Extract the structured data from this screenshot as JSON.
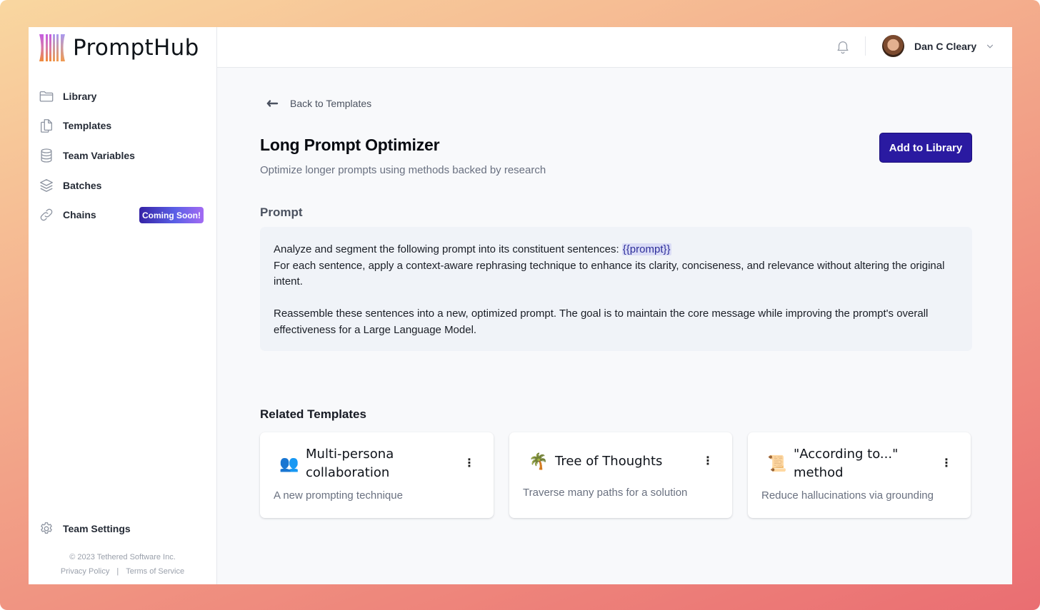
{
  "app": {
    "name": "PromptHub"
  },
  "sidebar": {
    "items": [
      {
        "label": "Library",
        "icon": "folder-icon"
      },
      {
        "label": "Templates",
        "icon": "documents-icon"
      },
      {
        "label": "Team Variables",
        "icon": "database-icon"
      },
      {
        "label": "Batches",
        "icon": "layers-icon"
      },
      {
        "label": "Chains",
        "icon": "link-icon",
        "badge": "Coming Soon!"
      }
    ],
    "settings": {
      "label": "Team Settings",
      "icon": "gear-icon"
    },
    "footer": {
      "copyright": "© 2023 Tethered Software Inc.",
      "privacy": "Privacy Policy",
      "separator": "|",
      "terms": "Terms of Service"
    }
  },
  "topbar": {
    "notifications_icon": "bell-icon",
    "user_name": "Dan C Cleary"
  },
  "page": {
    "back_label": "Back to Templates",
    "title": "Long Prompt Optimizer",
    "subtitle": "Optimize longer prompts using methods backed by research",
    "add_button": "Add to Library",
    "prompt_heading": "Prompt",
    "prompt": {
      "line1_text": "Analyze and segment the following prompt into its constituent sentences: ",
      "line1_variable": "{{prompt}}",
      "line2": "For each sentence, apply a context-aware rephrasing technique to enhance its clarity, conciseness, and relevance without altering the original intent.",
      "paragraph2": "Reassemble these sentences into a new, optimized prompt. The goal is to maintain the core message while improving the prompt's overall effectiveness for a Large Language Model."
    },
    "related_heading": "Related Templates",
    "related": [
      {
        "emoji": "👥",
        "title": "Multi-persona collaboration",
        "description": "A new prompting technique"
      },
      {
        "emoji": "🌴",
        "title": "Tree of Thoughts",
        "description": "Traverse many paths for a solution"
      },
      {
        "emoji": "📜",
        "title": "\"According to...\" method",
        "description": "Reduce hallucinations via grounding"
      }
    ]
  },
  "colors": {
    "accent": "#2a1aa1",
    "variable_bg": "#dadcf6",
    "prompt_bg": "#f0f3f8"
  }
}
